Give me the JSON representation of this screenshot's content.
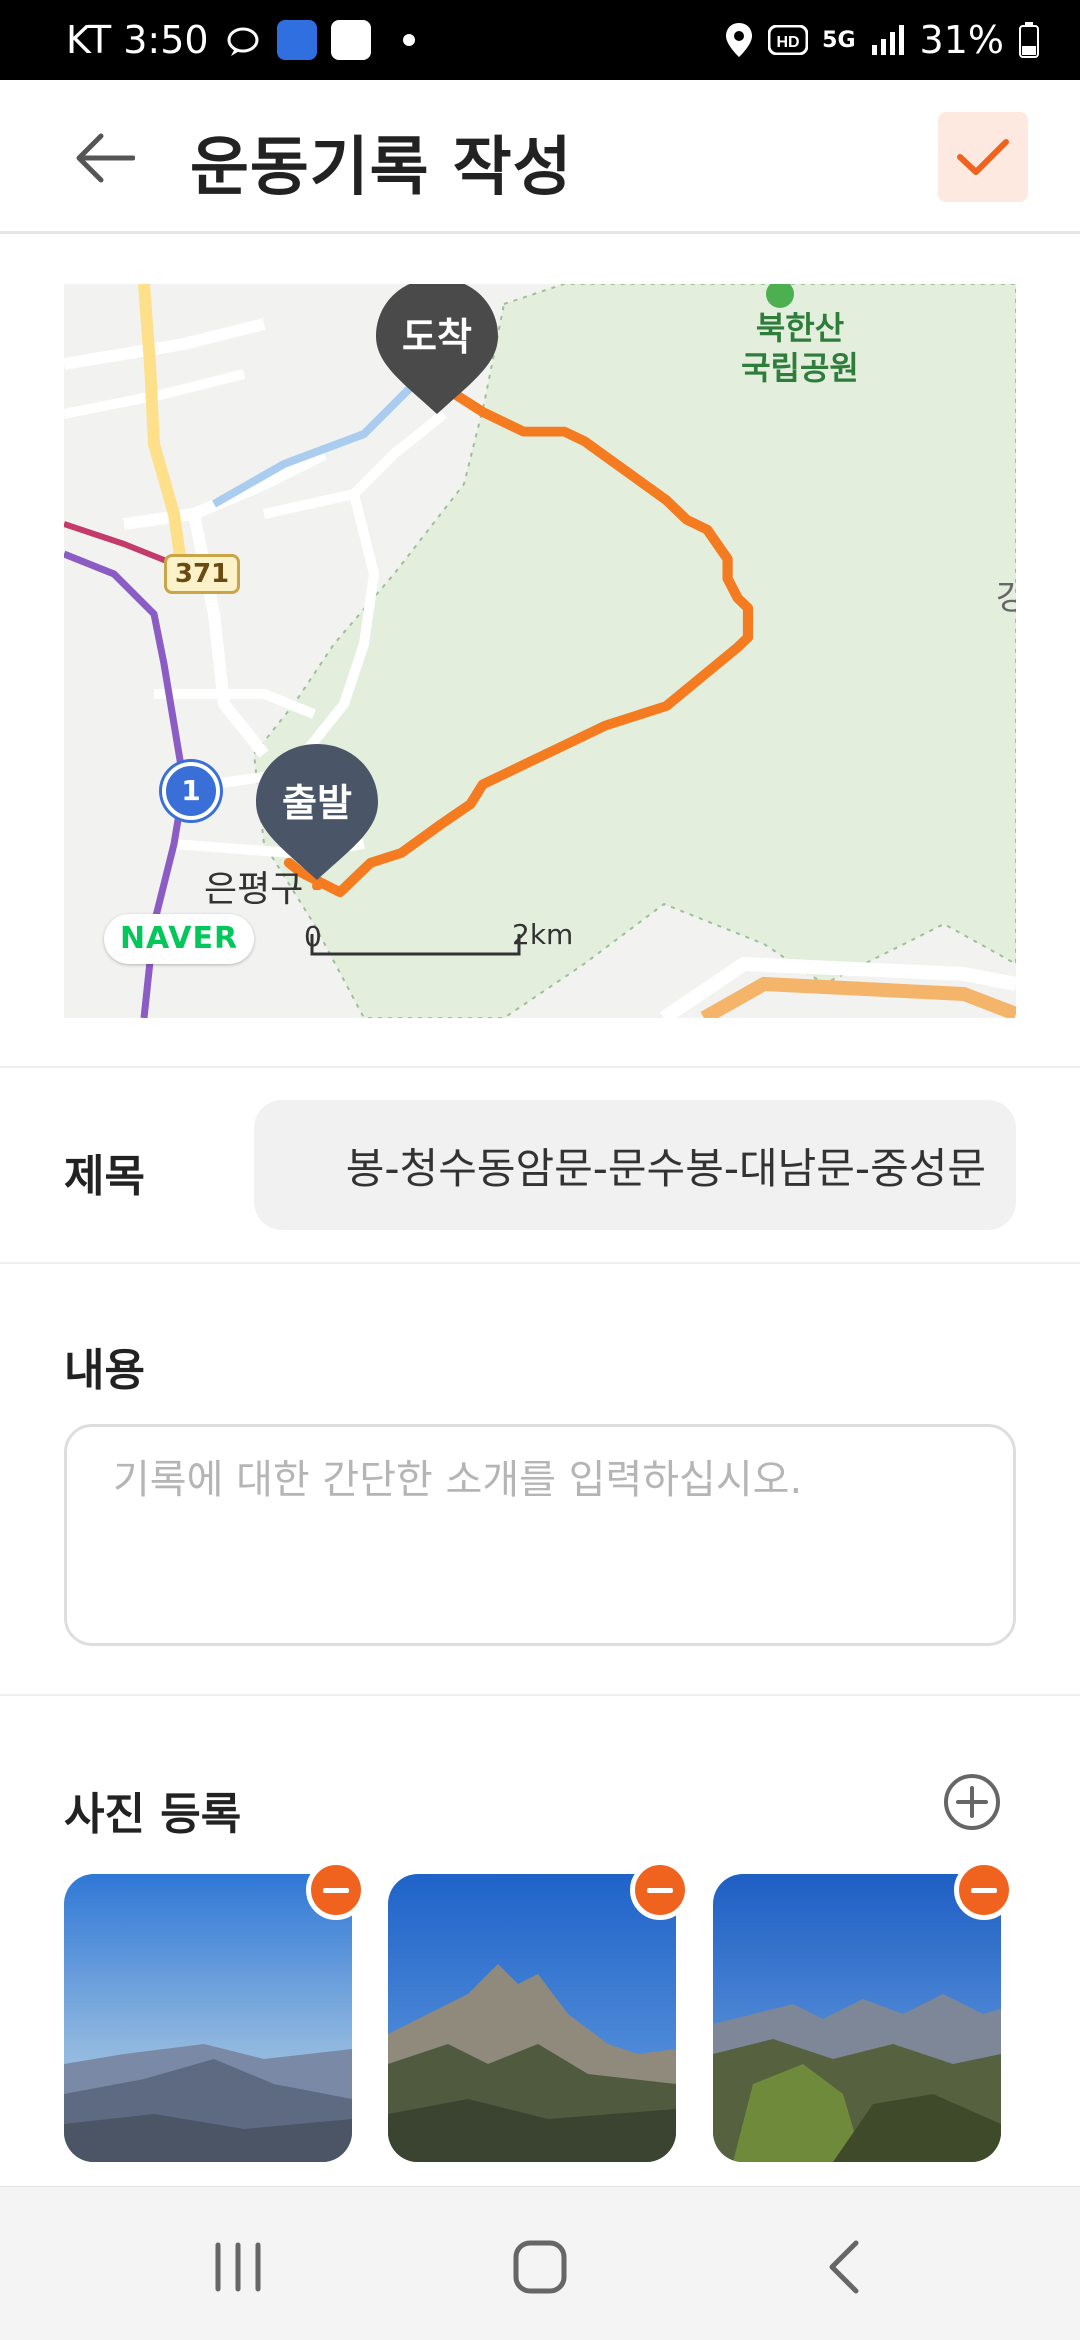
{
  "status_bar": {
    "carrier_time": "KT 3:50",
    "network": "5G",
    "battery": "31%",
    "icons": [
      "kakao-icon",
      "app-icon",
      "pay-icon",
      "location-icon",
      "hd-icon",
      "signal-icon",
      "battery-icon"
    ]
  },
  "header": {
    "title": "운동기록 작성",
    "back_icon": "arrow-left-icon",
    "confirm_icon": "check-icon",
    "accent_color": "#f0631f"
  },
  "map": {
    "start_label": "출발",
    "end_label": "도착",
    "park_name_line1": "북한산",
    "park_name_line2": "국립공원",
    "district": "은평구",
    "road_371": "371",
    "road_1": "1",
    "edge_label": "강",
    "naver": "NAVER",
    "scale_start": "0",
    "scale_end": "2km",
    "route_color": "#f47b20"
  },
  "form": {
    "title_label": "제목",
    "title_value": "봉-청수동암문-문수봉-대남문-중성문",
    "content_label": "내용",
    "content_placeholder": "기록에 대한 간단한 소개를 입력하십시오.",
    "photos_label": "사진 등록"
  },
  "photos": [
    {
      "name": "photo-1",
      "remove_icon": "minus-circle-icon"
    },
    {
      "name": "photo-2",
      "remove_icon": "minus-circle-icon"
    },
    {
      "name": "photo-3",
      "remove_icon": "minus-circle-icon"
    }
  ],
  "nav": {
    "recent_icon": "recent-apps-icon",
    "home_icon": "home-icon",
    "back_icon": "back-chevron-icon"
  }
}
